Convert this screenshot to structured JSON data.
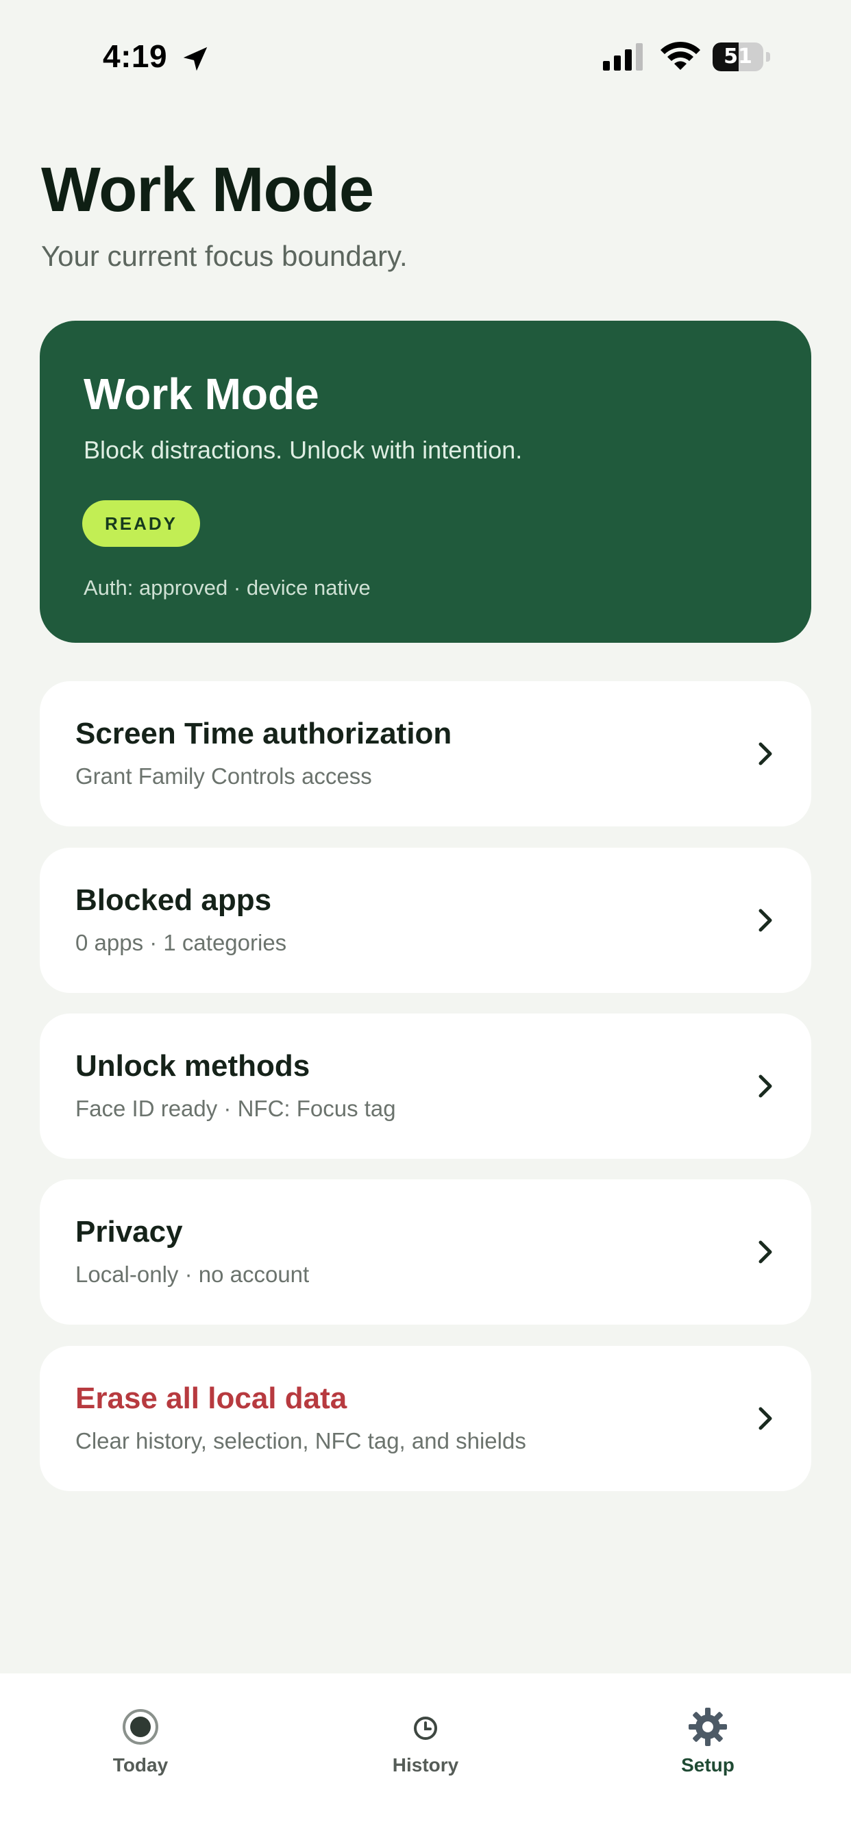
{
  "status_bar": {
    "time": "4:19",
    "battery_percent": "51",
    "battery_level": 0.51
  },
  "header": {
    "title": "Work Mode",
    "subtitle": "Your current focus boundary."
  },
  "hero_card": {
    "title": "Work Mode",
    "subtitle": "Block distractions. Unlock with intention.",
    "badge": "READY",
    "meta": "Auth: approved · device native",
    "color": "#205a3c",
    "badge_color": "#c2ee54"
  },
  "settings": [
    {
      "title": "Screen Time authorization",
      "subtitle": "Grant Family Controls access",
      "icon": "chevron-right-icon"
    },
    {
      "title": "Blocked apps",
      "subtitle": "0 apps · 1 categories",
      "icon": "chevron-right-icon"
    },
    {
      "title": "Unlock methods",
      "subtitle": "Face ID ready · NFC: Focus tag",
      "icon": "chevron-right-icon"
    },
    {
      "title": "Privacy",
      "subtitle": "Local-only · no account",
      "icon": "chevron-right-icon"
    },
    {
      "title": "Erase all local data",
      "subtitle": "Clear history, selection, NFC tag, and shields",
      "icon": "chevron-right-icon",
      "danger_color": "#b73a3f"
    }
  ],
  "tab_bar": {
    "tabs": [
      {
        "label": "Today",
        "icon": "record-icon"
      },
      {
        "label": "History",
        "icon": "clock-icon"
      },
      {
        "label": "Setup",
        "icon": "gear-icon",
        "active": true
      }
    ]
  }
}
